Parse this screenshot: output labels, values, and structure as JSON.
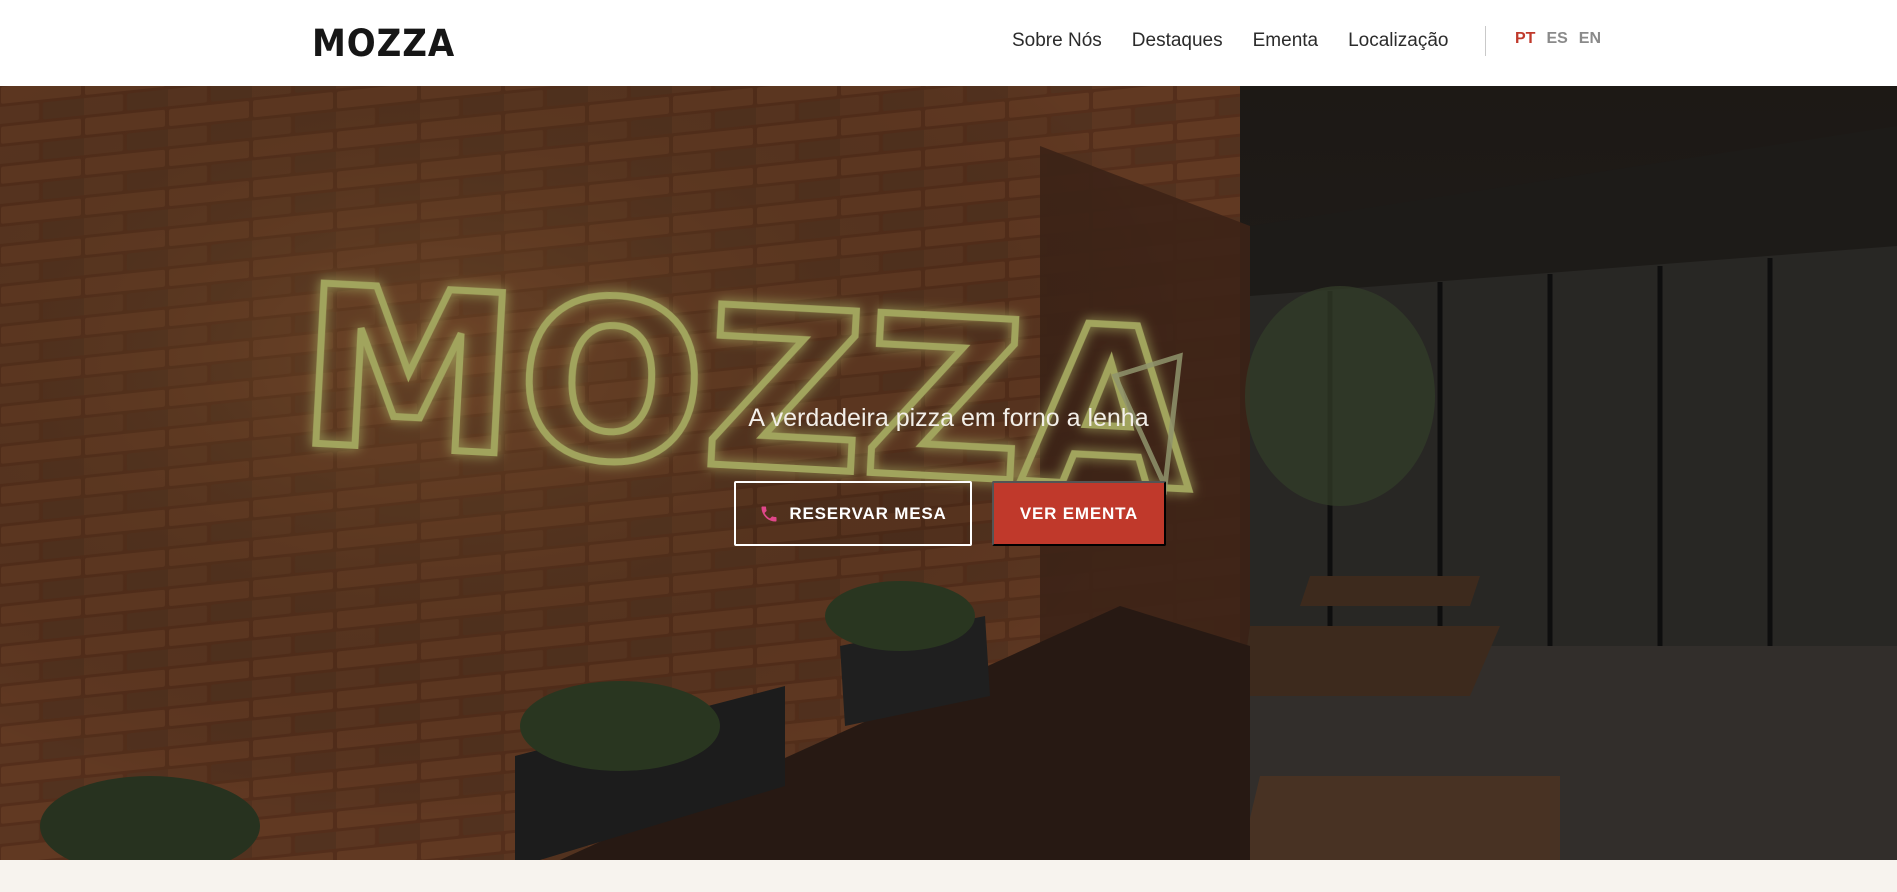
{
  "header": {
    "logo": "MOZZA",
    "nav": [
      {
        "label": "Sobre Nós"
      },
      {
        "label": "Destaques"
      },
      {
        "label": "Ementa"
      },
      {
        "label": "Localização"
      }
    ],
    "languages": [
      {
        "code": "PT",
        "active": true
      },
      {
        "code": "ES",
        "active": false
      },
      {
        "code": "EN",
        "active": false
      }
    ]
  },
  "hero": {
    "neon_sign": "MOZZA",
    "tagline": "A verdadeira pizza em forno a lenha",
    "reserve_button": {
      "label": "RESERVAR MESA",
      "icon": "phone-icon"
    },
    "menu_button": {
      "label": "VER EMENTA"
    }
  },
  "colors": {
    "accent": "#c0392b",
    "header_bg": "#ffffff",
    "page_bg": "#f7f3ee",
    "neon": "#e8f06a"
  }
}
